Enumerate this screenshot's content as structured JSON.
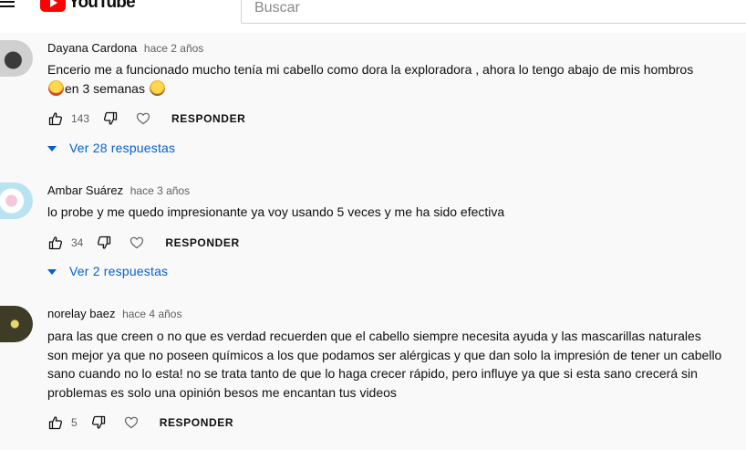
{
  "header": {
    "logo_text": "YouTube",
    "search_placeholder": "Buscar"
  },
  "comments": [
    {
      "author": "Dayana Cardona",
      "time": "hace 2 años",
      "text_part1": "Encerio me a funcionado mucho tenía mi cabello como dora la exploradora , ahora lo tengo abajo de mis hombros ",
      "text_part2": "en 3 semanas ",
      "likes": "143",
      "reply_label": "RESPONDER",
      "replies_label": "Ver 28 respuestas"
    },
    {
      "author": "Ambar Suárez",
      "time": "hace 3 años",
      "text": "lo probe y me quedo impresionante ya voy usando 5 veces y me ha sido efectiva",
      "likes": "34",
      "reply_label": "RESPONDER",
      "replies_label": "Ver 2 respuestas"
    },
    {
      "author": "norelay baez",
      "time": "hace 4 años",
      "text": "para las que creen o no que es verdad recuerden que el cabello siempre necesita ayuda y las mascarillas naturales son mejor ya que no poseen químicos a los que podamos ser alérgicas y que dan solo la impresión de tener un cabello sano cuando no lo esta! no se trata tanto de que lo haga crecer rápido, pero influye ya que si esta sano crecerá sin problemas es solo una opinión besos me encantan tus videos",
      "likes": "5",
      "reply_label": "RESPONDER"
    }
  ],
  "colors": {
    "link_blue": "#065fd4",
    "secondary_text": "#606060",
    "brand_red": "#ff0000"
  },
  "icons": [
    "menu-icon",
    "youtube-logo-icon",
    "thumb-up-icon",
    "thumb-down-icon",
    "heart-icon",
    "caret-down-icon",
    "star-struck-emoji",
    "sad-emoji"
  ]
}
